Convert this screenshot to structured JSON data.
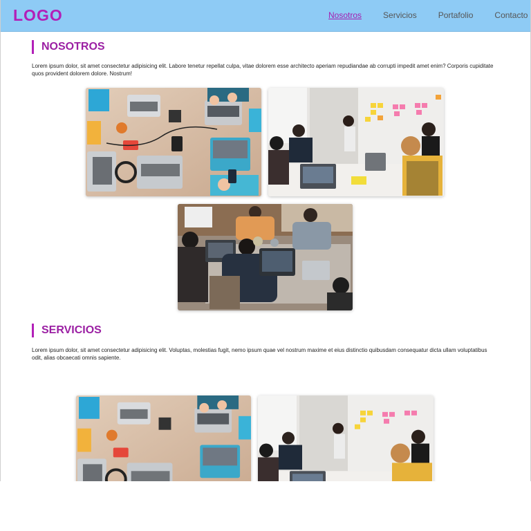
{
  "header": {
    "logo": "LOGO",
    "nav": [
      {
        "label": "Nosotros",
        "active": true
      },
      {
        "label": "Servicios",
        "active": false
      },
      {
        "label": "Portafolio",
        "active": false
      },
      {
        "label": "Contacto",
        "active": false
      }
    ]
  },
  "sections": {
    "nosotros": {
      "title": "NOSOTROS",
      "text": "Lorem ipsum dolor, sit amet consectetur adipisicing elit. Labore tenetur repellat culpa, vitae dolorem esse architecto aperiam repudiandae ab corrupti impedit amet enim? Corporis cupiditate quos provident dolorem dolore. Nostrum!"
    },
    "servicios": {
      "title": "SERVICIOS",
      "text": "Lorem ipsum dolor, sit amet consectetur adipisicing elit. Voluptas, molestias fugit, nemo ipsum quae vel nostrum maxime et eius distinctio quibusdam consequatur dicta ullam voluptatibus odit, alias obcaecati omnis sapiente."
    }
  },
  "images": {
    "desk_top_view": "photo-desk-laptops",
    "sticky_notes_meeting": "photo-team-meeting",
    "team_working": "photo-team-working"
  },
  "colors": {
    "header_bg": "#8ecbf5",
    "brand": "#b21fb8"
  }
}
